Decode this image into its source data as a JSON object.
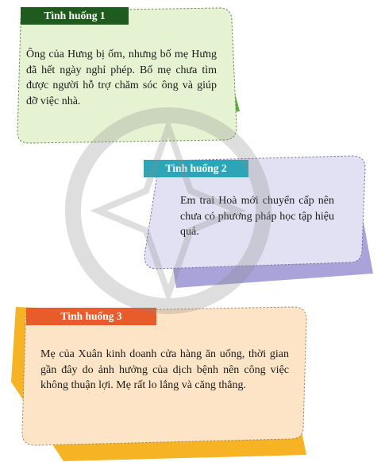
{
  "situation_1": {
    "label": "Tình huống 1",
    "text": "Ông của Hưng bị ốm, nhưng bố mẹ Hưng đã hết ngày nghỉ phép. Bố mẹ chưa tìm được người hỗ trợ chăm sóc ông và giúp đỡ việc nhà."
  },
  "situation_2": {
    "label": "Tình huống 2",
    "text": "Em trai Hoà mới chuyển cấp nên chưa có phương pháp học tập hiệu quả."
  },
  "situation_3": {
    "label": "Tình huống 3",
    "text": "Mẹ của Xuân kinh doanh cửa hàng ăn uống, thời gian gần đây do ảnh hưởng của dịch bệnh nên công việc không thuận lợi. Mẹ rất lo lắng và căng thẳng."
  },
  "colors": {
    "card1_back": "#5fae3a",
    "card1_front": "#e6f3d3",
    "card1_label": "#1f5a1e",
    "card2_back": "#a9a3d9",
    "card2_front": "#e2e1f3",
    "card2_label": "#2aa6b8",
    "card3_back": "#f6b323",
    "card3_front": "#fde4c6",
    "card3_label": "#e85c2b"
  }
}
